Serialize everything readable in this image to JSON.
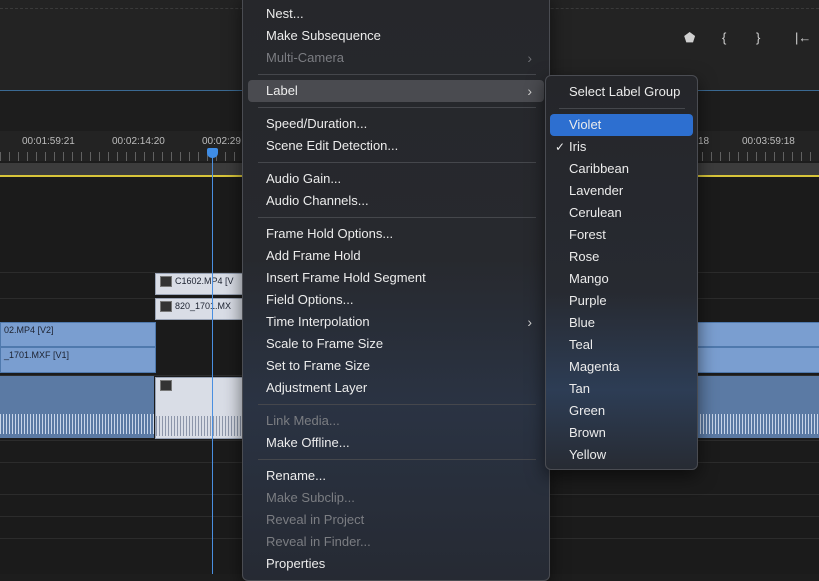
{
  "timeline": {
    "timecodes": [
      "00:01:59:21",
      "00:02:14:20",
      "00:02:29",
      "18",
      "00:03:59:18"
    ],
    "clips": {
      "v3_clip": "C1602.MP4 [V",
      "v2_clip_small": "820_1701.MX",
      "v2_track": "02.MP4 [V2]",
      "v1_track": "_1701.MXF [V1]"
    },
    "toolbar_icons": [
      "marker-icon",
      "in-brace-icon",
      "out-brace-icon",
      "go-to-in-icon"
    ]
  },
  "context_menu": {
    "items": [
      {
        "label": "Nest...",
        "enabled": true
      },
      {
        "label": "Make Subsequence",
        "enabled": true
      },
      {
        "label": "Multi-Camera",
        "enabled": false,
        "submenu": true
      },
      {
        "label": "Label",
        "enabled": true,
        "submenu": true,
        "highlighted": true
      },
      {
        "label": "Speed/Duration...",
        "enabled": true
      },
      {
        "label": "Scene Edit Detection...",
        "enabled": true
      },
      {
        "label": "Audio Gain...",
        "enabled": true
      },
      {
        "label": "Audio Channels...",
        "enabled": true
      },
      {
        "label": "Frame Hold Options...",
        "enabled": true
      },
      {
        "label": "Add Frame Hold",
        "enabled": true
      },
      {
        "label": "Insert Frame Hold Segment",
        "enabled": true
      },
      {
        "label": "Field Options...",
        "enabled": true
      },
      {
        "label": "Time Interpolation",
        "enabled": true,
        "submenu": true
      },
      {
        "label": "Scale to Frame Size",
        "enabled": true
      },
      {
        "label": "Set to Frame Size",
        "enabled": true
      },
      {
        "label": "Adjustment Layer",
        "enabled": true
      },
      {
        "label": "Link Media...",
        "enabled": false
      },
      {
        "label": "Make Offline...",
        "enabled": true
      },
      {
        "label": "Rename...",
        "enabled": true
      },
      {
        "label": "Make Subclip...",
        "enabled": false
      },
      {
        "label": "Reveal in Project",
        "enabled": false
      },
      {
        "label": "Reveal in Finder...",
        "enabled": false
      },
      {
        "label": "Properties",
        "enabled": true
      }
    ]
  },
  "label_submenu": {
    "header": "Select Label Group",
    "items": [
      {
        "label": "Violet",
        "selected": true
      },
      {
        "label": "Iris",
        "checked": true
      },
      {
        "label": "Caribbean"
      },
      {
        "label": "Lavender"
      },
      {
        "label": "Cerulean"
      },
      {
        "label": "Forest"
      },
      {
        "label": "Rose"
      },
      {
        "label": "Mango"
      },
      {
        "label": "Purple"
      },
      {
        "label": "Blue"
      },
      {
        "label": "Teal"
      },
      {
        "label": "Magenta"
      },
      {
        "label": "Tan"
      },
      {
        "label": "Green"
      },
      {
        "label": "Brown"
      },
      {
        "label": "Yellow"
      }
    ],
    "check_mark": "✓"
  },
  "colors": {
    "selection": "#2d6fd0",
    "playhead": "#3f8de6",
    "work_area": "#d8c53a",
    "clip_blue": "#7a9ed0"
  }
}
